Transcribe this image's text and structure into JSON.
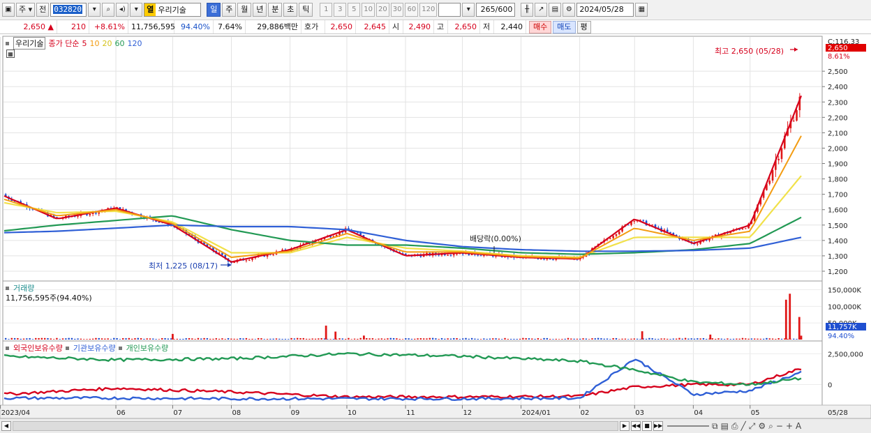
{
  "toolbar": {
    "market_label": "주",
    "prev_label": "전",
    "stock_code": "032820",
    "tag_label": "열",
    "stock_name": "우리기술",
    "periods": [
      "일",
      "주",
      "월",
      "년",
      "분",
      "초",
      "틱"
    ],
    "active_period": "일",
    "intervals": [
      "1",
      "3",
      "5",
      "10",
      "20",
      "30",
      "60",
      "120"
    ],
    "count": "265",
    "count_total": "/600",
    "date": "2024/05/28"
  },
  "info": {
    "price": "2,650",
    "up_arrow": "▲",
    "change": "210",
    "change_pct": "+8.61%",
    "volume": "11,756,595",
    "vol_ratio": "94.40%",
    "turnover": "7.64%",
    "amount": "29,886백만",
    "bid_label": "호가",
    "bid_price": "2,650",
    "ask_price": "2,645",
    "open_label": "시",
    "open": "2,490",
    "high_label": "고",
    "high": "2,650",
    "low_label": "저",
    "low": "2,440",
    "buy": "매수",
    "sell": "매도",
    "avg": "평"
  },
  "price_panel": {
    "stock_tag": "우리기술",
    "ma_label": "종가 단순",
    "ma_periods": [
      "5",
      "10",
      "20",
      "60",
      "120"
    ],
    "ma_colors": [
      "#d6001c",
      "#f39c12",
      "#f1e14a",
      "#229954",
      "#2f5fd6"
    ],
    "y_ticks": [
      "2,500",
      "2,400",
      "2,300",
      "2,200",
      "2,100",
      "2,000",
      "1,900",
      "1,800",
      "1,700",
      "1,600",
      "1,500",
      "1,400",
      "1,300",
      "1,200"
    ],
    "top_tick": "C:116.33",
    "current_price_tag": "2,650",
    "current_pct_tag": "8.61%",
    "high_annotation": "최고 2,650 (05/28)",
    "low_annotation": "최저 1,225 (08/17)",
    "dividend_annotation": "배당락(0.00%)"
  },
  "volume_panel": {
    "title": "거래량",
    "value_label": "11,756,595주(94.40%)",
    "y_ticks": [
      "150,000K",
      "100,000K",
      "50,000K"
    ],
    "current_tag": "11,757K",
    "pct_tag": "94.40%"
  },
  "holding_panel": {
    "legend": [
      "외국인보유수량",
      "기관보유수량",
      "개인보유수량"
    ],
    "colors": [
      "#d6001c",
      "#2f5fd6",
      "#229954"
    ],
    "y_ticks": [
      "2,500,000",
      "0"
    ]
  },
  "x_axis": {
    "labels": [
      "2023/04",
      "06",
      "07",
      "08",
      "09",
      "10",
      "11",
      "12",
      "2024/01",
      "02",
      "03",
      "04",
      "05"
    ],
    "end_label": "05/28"
  },
  "chart_data": [
    {
      "type": "line",
      "panel": "price",
      "y_unit": "KRW",
      "ylim": [
        1150,
        2700
      ],
      "series": [
        {
          "name": "5",
          "x": [
            "2023/04",
            "2023/05",
            "2023/06",
            "2023/07",
            "2023/08",
            "2023/09",
            "2023/10",
            "2023/11",
            "2023/12",
            "2024/01",
            "2024/02",
            "2024/03",
            "2024/04",
            "2024/05",
            "2024/05/28"
          ],
          "values": [
            1700,
            1540,
            1610,
            1500,
            1260,
            1340,
            1470,
            1300,
            1320,
            1290,
            1280,
            1540,
            1380,
            1500,
            2340
          ]
        },
        {
          "name": "20",
          "x": [
            "2023/04",
            "2023/05",
            "2023/06",
            "2023/07",
            "2023/08",
            "2023/09",
            "2023/10",
            "2023/11",
            "2023/12",
            "2024/01",
            "2024/02",
            "2024/03",
            "2024/04",
            "2024/05",
            "2024/05/28"
          ],
          "values": [
            1650,
            1580,
            1590,
            1520,
            1320,
            1320,
            1420,
            1350,
            1330,
            1300,
            1290,
            1420,
            1420,
            1420,
            1820
          ]
        },
        {
          "name": "60",
          "x": [
            "2023/04",
            "2023/05",
            "2023/06",
            "2023/07",
            "2023/08",
            "2023/09",
            "2023/10",
            "2023/11",
            "2023/12",
            "2024/01",
            "2024/02",
            "2024/03",
            "2024/04",
            "2024/05",
            "2024/05/28"
          ],
          "values": [
            1460,
            1500,
            1530,
            1560,
            1470,
            1400,
            1370,
            1370,
            1350,
            1320,
            1310,
            1320,
            1340,
            1380,
            1550
          ]
        },
        {
          "name": "120",
          "x": [
            "2023/04",
            "2023/05",
            "2023/06",
            "2023/07",
            "2023/08",
            "2023/09",
            "2023/10",
            "2023/11",
            "2023/12",
            "2024/01",
            "2024/02",
            "2024/03",
            "2024/04",
            "2024/05",
            "2024/05/28"
          ],
          "values": [
            1450,
            1460,
            1480,
            1500,
            1490,
            1490,
            1470,
            1400,
            1360,
            1340,
            1330,
            1330,
            1335,
            1350,
            1420
          ]
        }
      ]
    },
    {
      "type": "bar",
      "panel": "volume",
      "y_unit": "K shares",
      "ylim": [
        0,
        170000
      ],
      "highlights": [
        {
          "x": "2023/07",
          "value": 17000
        },
        {
          "x": "2023/09/20",
          "value": 42000
        },
        {
          "x": "2023/09/25",
          "value": 24000
        },
        {
          "x": "2023/10/10",
          "value": 12000
        },
        {
          "x": "2024/03/05",
          "value": 25000
        },
        {
          "x": "2024/04/10",
          "value": 15000
        },
        {
          "x": "2024/05/20",
          "value": 120000
        },
        {
          "x": "2024/05/22",
          "value": 138000
        },
        {
          "x": "2024/05/27",
          "value": 68000
        },
        {
          "x": "2024/05/28",
          "value": 11757
        }
      ]
    },
    {
      "type": "line",
      "panel": "holdings",
      "ylim": [
        -1500000,
        3200000
      ],
      "series": [
        {
          "name": "외국인보유수량",
          "x": [
            "2023/04",
            "2023/06",
            "2023/08",
            "2023/10",
            "2023/12",
            "2024/02",
            "2024/03",
            "2024/04",
            "2024/05",
            "2024/05/28"
          ],
          "values": [
            -800000,
            -300000,
            -600000,
            -1000000,
            -1000000,
            -950000,
            -200000,
            0,
            0,
            1300000
          ]
        },
        {
          "name": "기관보유수량",
          "x": [
            "2023/04",
            "2023/06",
            "2023/08",
            "2023/10",
            "2023/12",
            "2024/02",
            "2024/03",
            "2024/04",
            "2024/05",
            "2024/05/28"
          ],
          "values": [
            -1100000,
            -1100000,
            -1150000,
            -1150000,
            -1150000,
            -1100000,
            2100000,
            -800000,
            -500000,
            1000000
          ]
        },
        {
          "name": "개인보유수량",
          "x": [
            "2023/04",
            "2023/06",
            "2023/08",
            "2023/10",
            "2023/12",
            "2024/02",
            "2024/03",
            "2024/04",
            "2024/05",
            "2024/05/28"
          ],
          "values": [
            2300000,
            2000000,
            2100000,
            2500000,
            2300000,
            1900000,
            1200000,
            200000,
            0,
            500000
          ]
        }
      ]
    }
  ]
}
